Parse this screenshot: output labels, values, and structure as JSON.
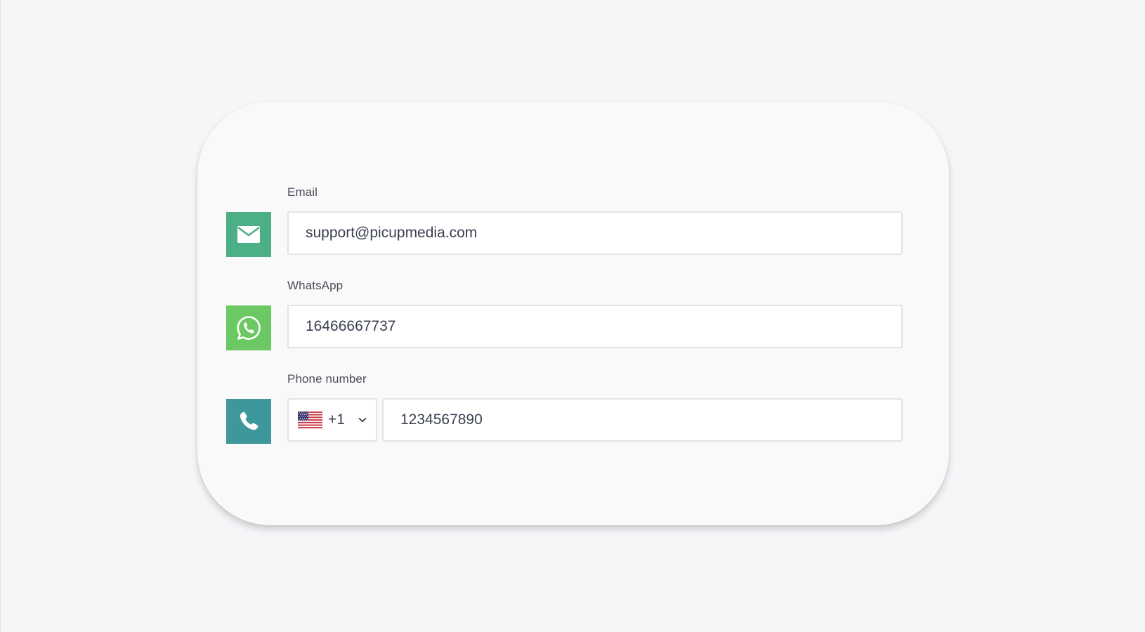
{
  "form": {
    "email": {
      "label": "Email",
      "value": "support@picupmedia.com",
      "icon": "envelope-icon",
      "color": "#4caf86"
    },
    "whatsapp": {
      "label": "WhatsApp",
      "value": "16466667737",
      "icon": "whatsapp-icon",
      "color": "#6cc862"
    },
    "phone": {
      "label": "Phone number",
      "country_flag": "us-flag-icon",
      "dial_code": "+1",
      "value": "1234567890",
      "icon": "phone-icon",
      "color": "#3e989b"
    }
  }
}
